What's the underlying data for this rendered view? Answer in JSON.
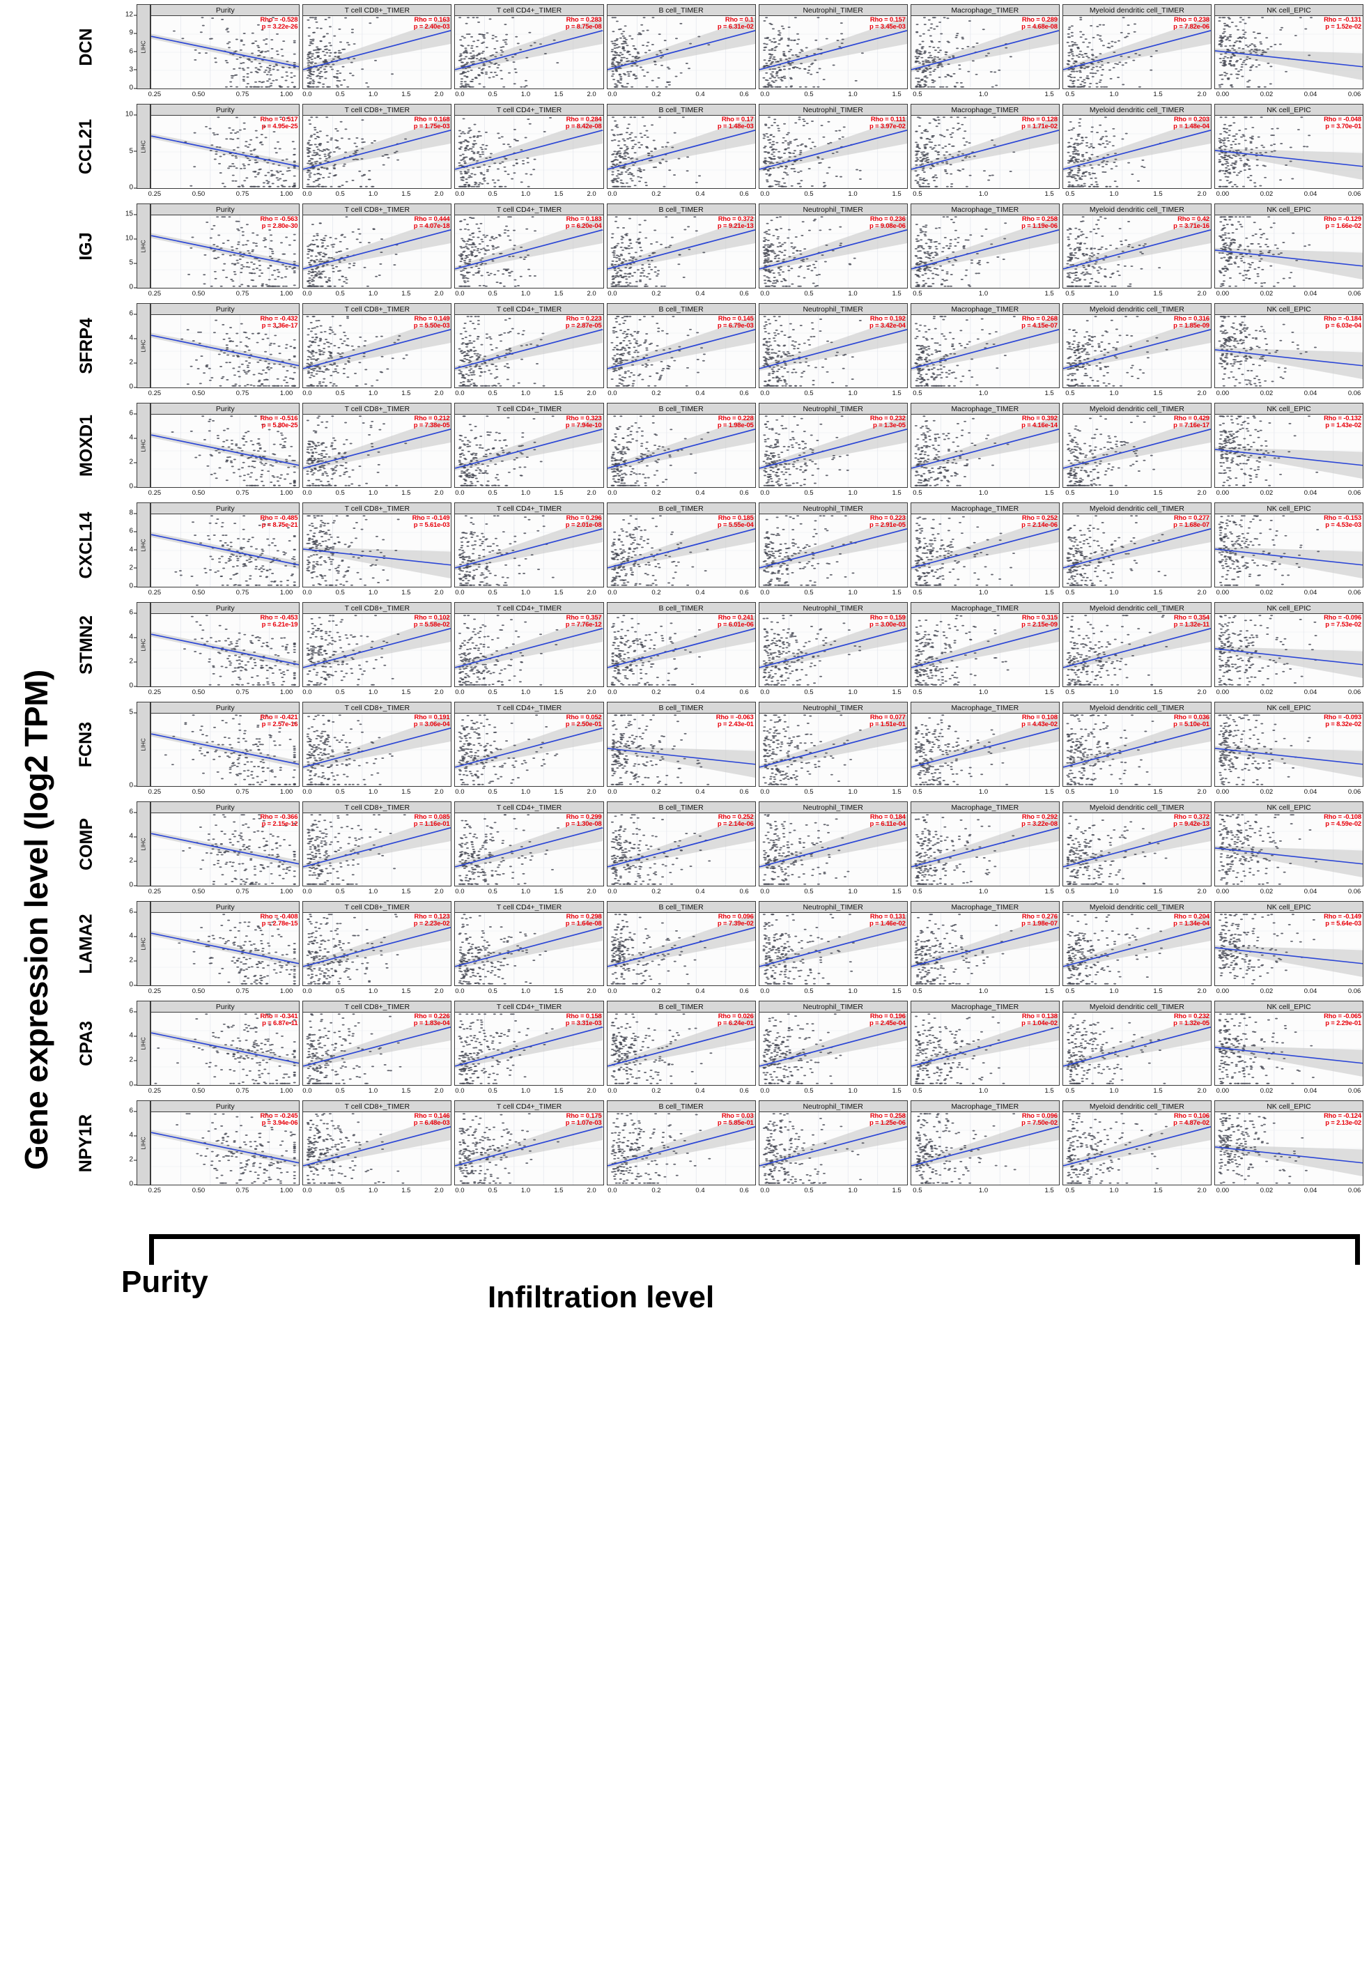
{
  "figure": {
    "y_axis_title": "Gene expression level (log2 TPM)",
    "bottom_left_caption": "Purity",
    "bottom_right_caption": "Infiltration level",
    "strip_label": "LIHC",
    "accent_stat_color": "#e8000b",
    "fit_line_color": "#2b46d6",
    "ci_band_color": "#c9c9c9",
    "point_color": "#434650",
    "panel_header_bg": "#d8d8d8"
  },
  "columns": [
    {
      "label": "Purity",
      "xticks": [
        "0.25",
        "0.50",
        "0.75",
        "1.00"
      ],
      "xmin": 0.12,
      "xmax": 1.03
    },
    {
      "label": "T cell CD8+_TIMER",
      "xticks": [
        "0.0",
        "0.5",
        "1.0",
        "1.5",
        "2.0"
      ],
      "xmin": -0.05,
      "xmax": 2.15
    },
    {
      "label": "T cell CD4+_TIMER",
      "xticks": [
        "0.0",
        "0.5",
        "1.0",
        "1.5",
        "2.0"
      ],
      "xmin": -0.05,
      "xmax": 2.15
    },
    {
      "label": "B cell_TIMER",
      "xticks": [
        "0.0",
        "0.2",
        "0.4",
        "0.6"
      ],
      "xmin": -0.02,
      "xmax": 0.7
    },
    {
      "label": "Neutrophil_TIMER",
      "xticks": [
        "0.0",
        "0.5",
        "1.0",
        "1.5"
      ],
      "xmin": -0.04,
      "xmax": 1.62
    },
    {
      "label": "Macrophage_TIMER",
      "xticks": [
        "0.5",
        "1.0",
        "1.5"
      ],
      "xmin": 0.3,
      "xmax": 1.58
    },
    {
      "label": "Myeloid dendritic cell_TIMER",
      "xticks": [
        "0.5",
        "1.0",
        "1.5",
        "2.0"
      ],
      "xmin": 0.28,
      "xmax": 2.2
    },
    {
      "label": "NK cell_EPIC",
      "xticks": [
        "0.00",
        "0.02",
        "0.04",
        "0.06"
      ],
      "xmin": -0.002,
      "xmax": 0.063
    }
  ],
  "chart_data": {
    "type": "scatter",
    "title": "",
    "xlabel": "Purity / Infiltration level",
    "ylabel": "Gene expression level (log2 TPM)",
    "cancer_type": "LIHC",
    "grid": true,
    "legend": "none",
    "annotation_format": "Rho = <value>  /  p = <value>",
    "columns": [
      "Purity",
      "T cell CD8+_TIMER",
      "T cell CD4+_TIMER",
      "B cell_TIMER",
      "Neutrophil_TIMER",
      "Macrophage_TIMER",
      "Myeloid dendritic cell_TIMER",
      "NK cell_EPIC"
    ],
    "rows": [
      {
        "gene": "DCN",
        "yticks": [
          "0",
          "3",
          "6",
          "9",
          "12"
        ],
        "ylim": [
          -0.6,
          12.6
        ],
        "cells": [
          {
            "rho": "-0.528",
            "p": "3.22e-26",
            "rho_v": -0.528,
            "slope": -1
          },
          {
            "rho": "0.163",
            "p": "2.40e-03",
            "rho_v": 0.163,
            "slope": 1
          },
          {
            "rho": "0.283",
            "p": "8.75e-08",
            "rho_v": 0.283,
            "slope": 1
          },
          {
            "rho": "0.1",
            "p": "6.31e-02",
            "rho_v": 0.1,
            "slope": 1
          },
          {
            "rho": "0.157",
            "p": "3.45e-03",
            "rho_v": 0.157,
            "slope": 1
          },
          {
            "rho": "0.289",
            "p": "4.68e-08",
            "rho_v": 0.289,
            "slope": 1
          },
          {
            "rho": "0.238",
            "p": "7.82e-06",
            "rho_v": 0.238,
            "slope": 1
          },
          {
            "rho": "-0.131",
            "p": "1.52e-02",
            "rho_v": -0.131,
            "slope": -1
          }
        ]
      },
      {
        "gene": "CCL21",
        "yticks": [
          "0",
          "5",
          "10"
        ],
        "ylim": [
          -0.6,
          13.0
        ],
        "cells": [
          {
            "rho": "-0.517",
            "p": "4.95e-25",
            "rho_v": -0.517,
            "slope": -1
          },
          {
            "rho": "0.168",
            "p": "1.75e-03",
            "rho_v": 0.168,
            "slope": 1
          },
          {
            "rho": "0.284",
            "p": "8.42e-08",
            "rho_v": 0.284,
            "slope": 1
          },
          {
            "rho": "0.17",
            "p": "1.48e-03",
            "rho_v": 0.17,
            "slope": 1
          },
          {
            "rho": "0.111",
            "p": "3.97e-02",
            "rho_v": 0.111,
            "slope": 1
          },
          {
            "rho": "0.128",
            "p": "1.71e-02",
            "rho_v": 0.128,
            "slope": 1
          },
          {
            "rho": "0.203",
            "p": "1.48e-04",
            "rho_v": 0.203,
            "slope": 1
          },
          {
            "rho": "-0.048",
            "p": "3.70e-01",
            "rho_v": -0.048,
            "slope": 1
          }
        ]
      },
      {
        "gene": "IGJ",
        "yticks": [
          "0",
          "5",
          "10",
          "15"
        ],
        "ylim": [
          -0.8,
          16.0
        ],
        "cells": [
          {
            "rho": "-0.563",
            "p": "2.80e-30",
            "rho_v": -0.563,
            "slope": -1
          },
          {
            "rho": "0.444",
            "p": "4.07e-18",
            "rho_v": 0.444,
            "slope": 1
          },
          {
            "rho": "0.183",
            "p": "6.20e-04",
            "rho_v": 0.183,
            "slope": 1
          },
          {
            "rho": "0.372",
            "p": "9.21e-13",
            "rho_v": 0.372,
            "slope": 1
          },
          {
            "rho": "0.236",
            "p": "9.08e-06",
            "rho_v": 0.236,
            "slope": 1
          },
          {
            "rho": "0.258",
            "p": "1.19e-06",
            "rho_v": 0.258,
            "slope": 1
          },
          {
            "rho": "0.42",
            "p": "3.71e-16",
            "rho_v": 0.42,
            "slope": 1
          },
          {
            "rho": "-0.129",
            "p": "1.66e-02",
            "rho_v": -0.129,
            "slope": -1
          }
        ]
      },
      {
        "gene": "SFRP4",
        "yticks": [
          "0",
          "2",
          "4",
          "6"
        ],
        "ylim": [
          -0.4,
          7.4
        ],
        "cells": [
          {
            "rho": "-0.432",
            "p": "3.36e-17",
            "rho_v": -0.432,
            "slope": -1
          },
          {
            "rho": "0.149",
            "p": "5.50e-03",
            "rho_v": 0.149,
            "slope": 1
          },
          {
            "rho": "0.223",
            "p": "2.87e-05",
            "rho_v": 0.223,
            "slope": 1
          },
          {
            "rho": "0.145",
            "p": "6.79e-03",
            "rho_v": 0.145,
            "slope": 1
          },
          {
            "rho": "0.192",
            "p": "3.42e-04",
            "rho_v": 0.192,
            "slope": 1
          },
          {
            "rho": "0.268",
            "p": "4.15e-07",
            "rho_v": 0.268,
            "slope": 1
          },
          {
            "rho": "0.316",
            "p": "1.85e-09",
            "rho_v": 0.316,
            "slope": 1
          },
          {
            "rho": "-0.184",
            "p": "6.03e-04",
            "rho_v": -0.184,
            "slope": 1
          }
        ]
      },
      {
        "gene": "MOXD1",
        "yticks": [
          "0",
          "2",
          "4",
          "6"
        ],
        "ylim": [
          -0.4,
          7.4
        ],
        "cells": [
          {
            "rho": "-0.516",
            "p": "5.80e-25",
            "rho_v": -0.516,
            "slope": -1
          },
          {
            "rho": "0.212",
            "p": "7.38e-05",
            "rho_v": 0.212,
            "slope": 1
          },
          {
            "rho": "0.323",
            "p": "7.94e-10",
            "rho_v": 0.323,
            "slope": 1
          },
          {
            "rho": "0.228",
            "p": "1.98e-05",
            "rho_v": 0.228,
            "slope": 1
          },
          {
            "rho": "0.232",
            "p": "1.3e-05",
            "rho_v": 0.232,
            "slope": 1
          },
          {
            "rho": "0.392",
            "p": "4.16e-14",
            "rho_v": 0.392,
            "slope": 1
          },
          {
            "rho": "0.429",
            "p": "7.16e-17",
            "rho_v": 0.429,
            "slope": 1
          },
          {
            "rho": "-0.132",
            "p": "1.43e-02",
            "rho_v": -0.132,
            "slope": -1
          }
        ]
      },
      {
        "gene": "CXCL14",
        "yticks": [
          "0",
          "2",
          "4",
          "6",
          "8"
        ],
        "ylim": [
          -0.4,
          9.0
        ],
        "cells": [
          {
            "rho": "-0.485",
            "p": "8.75e-21",
            "rho_v": -0.485,
            "slope": -1
          },
          {
            "rho": "-0.149",
            "p": "5.61e-03",
            "rho_v": -0.149,
            "slope": 1
          },
          {
            "rho": "0.296",
            "p": "2.01e-08",
            "rho_v": 0.296,
            "slope": 1
          },
          {
            "rho": "0.185",
            "p": "5.55e-04",
            "rho_v": 0.185,
            "slope": 1
          },
          {
            "rho": "0.223",
            "p": "2.91e-05",
            "rho_v": 0.223,
            "slope": 1
          },
          {
            "rho": "0.252",
            "p": "2.14e-06",
            "rho_v": 0.252,
            "slope": 1
          },
          {
            "rho": "0.277",
            "p": "1.68e-07",
            "rho_v": 0.277,
            "slope": 1
          },
          {
            "rho": "-0.153",
            "p": "4.53e-03",
            "rho_v": -0.153,
            "slope": 1
          }
        ]
      },
      {
        "gene": "STMN2",
        "yticks": [
          "0",
          "2",
          "4",
          "6"
        ],
        "ylim": [
          -0.4,
          7.4
        ],
        "cells": [
          {
            "rho": "-0.453",
            "p": "6.21e-19",
            "rho_v": -0.453,
            "slope": -1
          },
          {
            "rho": "0.102",
            "p": "5.58e-02",
            "rho_v": 0.102,
            "slope": 1
          },
          {
            "rho": "0.357",
            "p": "7.76e-12",
            "rho_v": 0.357,
            "slope": 1
          },
          {
            "rho": "0.241",
            "p": "6.01e-06",
            "rho_v": 0.241,
            "slope": 1
          },
          {
            "rho": "0.159",
            "p": "3.00e-03",
            "rho_v": 0.159,
            "slope": 1
          },
          {
            "rho": "0.315",
            "p": "2.15e-09",
            "rho_v": 0.315,
            "slope": 1
          },
          {
            "rho": "0.354",
            "p": "1.32e-11",
            "rho_v": 0.354,
            "slope": 1
          },
          {
            "rho": "-0.096",
            "p": "7.53e-02",
            "rho_v": -0.096,
            "slope": 1
          }
        ]
      },
      {
        "gene": "FCN3",
        "yticks": [
          "0",
          "5"
        ],
        "ylim": [
          -0.4,
          8.6
        ],
        "cells": [
          {
            "rho": "-0.421",
            "p": "2.57e-16",
            "rho_v": -0.421,
            "slope": -1
          },
          {
            "rho": "0.191",
            "p": "3.06e-04",
            "rho_v": 0.191,
            "slope": 1
          },
          {
            "rho": "0.052",
            "p": "2.50e-01",
            "rho_v": 0.052,
            "slope": 1
          },
          {
            "rho": "-0.063",
            "p": "2.43e-01",
            "rho_v": -0.063,
            "slope": 1
          },
          {
            "rho": "0.077",
            "p": "1.51e-01",
            "rho_v": 0.077,
            "slope": 1
          },
          {
            "rho": "0.108",
            "p": "4.43e-02",
            "rho_v": 0.108,
            "slope": 1
          },
          {
            "rho": "0.036",
            "p": "5.10e-01",
            "rho_v": 0.036,
            "slope": 1
          },
          {
            "rho": "-0.093",
            "p": "8.32e-02",
            "rho_v": -0.093,
            "slope": 1
          }
        ]
      },
      {
        "gene": "COMP",
        "yticks": [
          "0",
          "2",
          "4",
          "6"
        ],
        "ylim": [
          -0.4,
          7.4
        ],
        "cells": [
          {
            "rho": "-0.366",
            "p": "2.15e-12",
            "rho_v": -0.366,
            "slope": -1
          },
          {
            "rho": "0.085",
            "p": "1.16e-01",
            "rho_v": 0.085,
            "slope": 1
          },
          {
            "rho": "0.299",
            "p": "1.30e-08",
            "rho_v": 0.299,
            "slope": 1
          },
          {
            "rho": "0.252",
            "p": "2.14e-06",
            "rho_v": 0.252,
            "slope": 1
          },
          {
            "rho": "0.184",
            "p": "6.11e-04",
            "rho_v": 0.184,
            "slope": 1
          },
          {
            "rho": "0.292",
            "p": "3.22e-08",
            "rho_v": 0.292,
            "slope": 1
          },
          {
            "rho": "0.372",
            "p": "9.42e-13",
            "rho_v": 0.372,
            "slope": 1
          },
          {
            "rho": "-0.108",
            "p": "4.59e-02",
            "rho_v": -0.108,
            "slope": 1
          }
        ]
      },
      {
        "gene": "LAMA2",
        "yticks": [
          "0",
          "2",
          "4",
          "6"
        ],
        "ylim": [
          -0.4,
          7.4
        ],
        "cells": [
          {
            "rho": "-0.408",
            "p": "2.78e-15",
            "rho_v": -0.408,
            "slope": -1
          },
          {
            "rho": "0.123",
            "p": "2.23e-02",
            "rho_v": 0.123,
            "slope": 1
          },
          {
            "rho": "0.298",
            "p": "1.64e-08",
            "rho_v": 0.298,
            "slope": 1
          },
          {
            "rho": "0.096",
            "p": "7.39e-02",
            "rho_v": 0.096,
            "slope": 1
          },
          {
            "rho": "0.131",
            "p": "1.46e-02",
            "rho_v": 0.131,
            "slope": 1
          },
          {
            "rho": "0.276",
            "p": "1.98e-07",
            "rho_v": 0.276,
            "slope": 1
          },
          {
            "rho": "0.204",
            "p": "1.34e-04",
            "rho_v": 0.204,
            "slope": 1
          },
          {
            "rho": "-0.149",
            "p": "5.64e-03",
            "rho_v": -0.149,
            "slope": -1
          }
        ]
      },
      {
        "gene": "CPA3",
        "yticks": [
          "0",
          "2",
          "4",
          "6"
        ],
        "ylim": [
          -0.4,
          7.4
        ],
        "cells": [
          {
            "rho": "-0.341",
            "p": "6.87e-11",
            "rho_v": -0.341,
            "slope": -1
          },
          {
            "rho": "0.226",
            "p": "1.83e-04",
            "rho_v": 0.226,
            "slope": 1
          },
          {
            "rho": "0.158",
            "p": "3.31e-03",
            "rho_v": 0.158,
            "slope": 1
          },
          {
            "rho": "0.026",
            "p": "6.24e-01",
            "rho_v": 0.026,
            "slope": 1
          },
          {
            "rho": "0.196",
            "p": "2.45e-04",
            "rho_v": 0.196,
            "slope": 1
          },
          {
            "rho": "0.138",
            "p": "1.04e-02",
            "rho_v": 0.138,
            "slope": 1
          },
          {
            "rho": "0.232",
            "p": "1.32e-05",
            "rho_v": 0.232,
            "slope": 1
          },
          {
            "rho": "-0.065",
            "p": "2.29e-01",
            "rho_v": -0.065,
            "slope": 1
          }
        ]
      },
      {
        "gene": "NPY1R",
        "yticks": [
          "0",
          "2",
          "4",
          "6"
        ],
        "ylim": [
          -0.4,
          7.4
        ],
        "cells": [
          {
            "rho": "-0.245",
            "p": "3.94e-06",
            "rho_v": -0.245,
            "slope": -1
          },
          {
            "rho": "0.146",
            "p": "6.48e-03",
            "rho_v": 0.146,
            "slope": 1
          },
          {
            "rho": "0.175",
            "p": "1.07e-03",
            "rho_v": 0.175,
            "slope": 1
          },
          {
            "rho": "0.03",
            "p": "5.85e-01",
            "rho_v": 0.03,
            "slope": 1
          },
          {
            "rho": "0.258",
            "p": "1.25e-06",
            "rho_v": 0.258,
            "slope": 1
          },
          {
            "rho": "0.096",
            "p": "7.50e-02",
            "rho_v": 0.096,
            "slope": 1
          },
          {
            "rho": "0.106",
            "p": "4.87e-02",
            "rho_v": 0.106,
            "slope": 1
          },
          {
            "rho": "-0.124",
            "p": "2.13e-02",
            "rho_v": -0.124,
            "slope": -1
          }
        ]
      }
    ]
  }
}
